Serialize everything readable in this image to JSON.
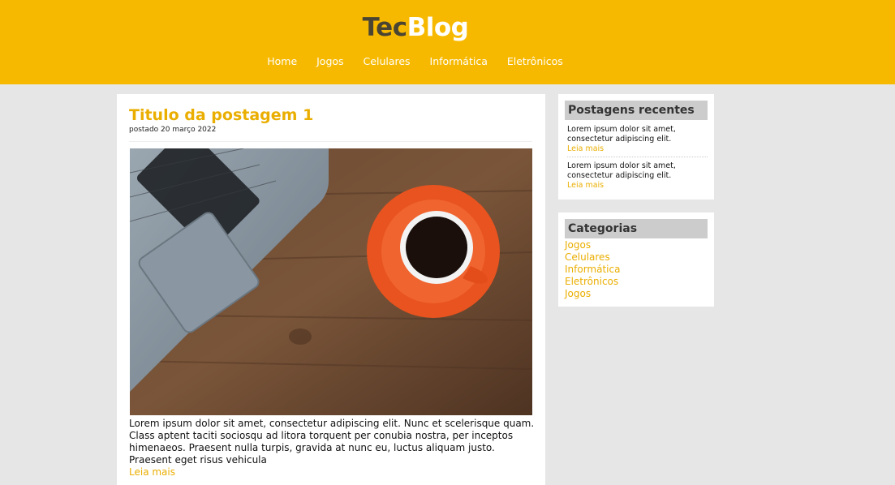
{
  "header": {
    "logo_part1": "Tec",
    "logo_part2": "Blog",
    "nav": [
      "Home",
      "Jogos",
      "Celulares",
      "Informática",
      "Eletrônicos"
    ]
  },
  "post": {
    "title": "Titulo da postagem 1",
    "date": "postado 20 março 2022",
    "body": "Lorem ipsum dolor sit amet, consectetur adipiscing elit. Nunc et scelerisque quam. Class aptent taciti sociosqu ad litora torquent per conubia nostra, per inceptos himenaeos. Praesent nulla turpis, gravida at nunc eu, luctus aliquam justo. Praesent eget risus vehicula",
    "read_more": "Leia mais"
  },
  "recent": {
    "title": "Postagens recentes",
    "items": [
      {
        "text": "Lorem ipsum dolor sit amet, consectetur adipiscing elit.",
        "link": "Leia mais"
      },
      {
        "text": "Lorem ipsum dolor sit amet, consectetur adipiscing elit.",
        "link": "Leia mais"
      }
    ]
  },
  "categories": {
    "title": "Categorias",
    "items": [
      "Jogos",
      "Celulares",
      "Informática",
      "Eletrônicos",
      "Jogos"
    ]
  },
  "colors": {
    "brand": "#f7b900",
    "accent_text": "#eaae00",
    "page_bg": "#e6e6e6"
  }
}
